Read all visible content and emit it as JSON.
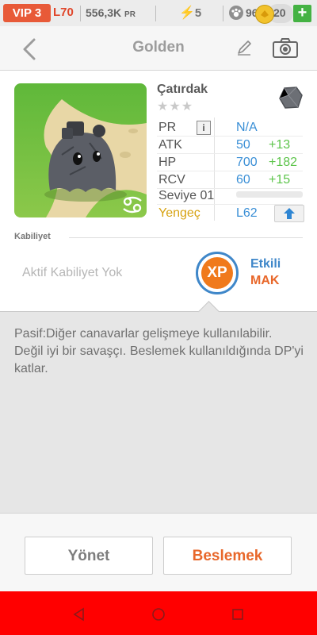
{
  "status": {
    "vip": "VIP 3",
    "level": "L70",
    "money": "556,3K",
    "money_unit": "PR",
    "energy": "5",
    "food": "96K",
    "gold": "20",
    "plus": "+"
  },
  "header": {
    "title": "Golden"
  },
  "monster": {
    "name": "Çatırdak",
    "stars": "★★★",
    "rarity_stars": 3,
    "element_icon": "cancer-zodiac-icon",
    "stats": [
      {
        "label": "PR",
        "value": "N/A",
        "bonus": ""
      },
      {
        "label": "ATK",
        "value": "50",
        "bonus": "+13"
      },
      {
        "label": "HP",
        "value": "700",
        "bonus": "+182"
      },
      {
        "label": "RCV",
        "value": "60",
        "bonus": "+15"
      }
    ],
    "level_label": "Seviye 01",
    "xp_progress": 0,
    "sign": "Yengeç",
    "level_cap": "L62",
    "info_glyph": "i"
  },
  "ability": {
    "section_label": "Kabiliyet",
    "active": "Aktif Kabiliyet Yok",
    "badge": "XP",
    "effect": "Etkili",
    "effect_value": "MAK"
  },
  "description": "Pasif:Diğer canavarlar gelişmeye kullanılabilir. Değil iyi bir savaşçı. Beslemek kullanıldığında DP'yi katlar.",
  "buttons": {
    "manage": "Yönet",
    "feed": "Beslemek"
  },
  "colors": {
    "accent_orange": "#e8672a",
    "accent_blue": "#3f87c9",
    "bonus_green": "#5cc44a",
    "navbar": "#ff0000"
  }
}
